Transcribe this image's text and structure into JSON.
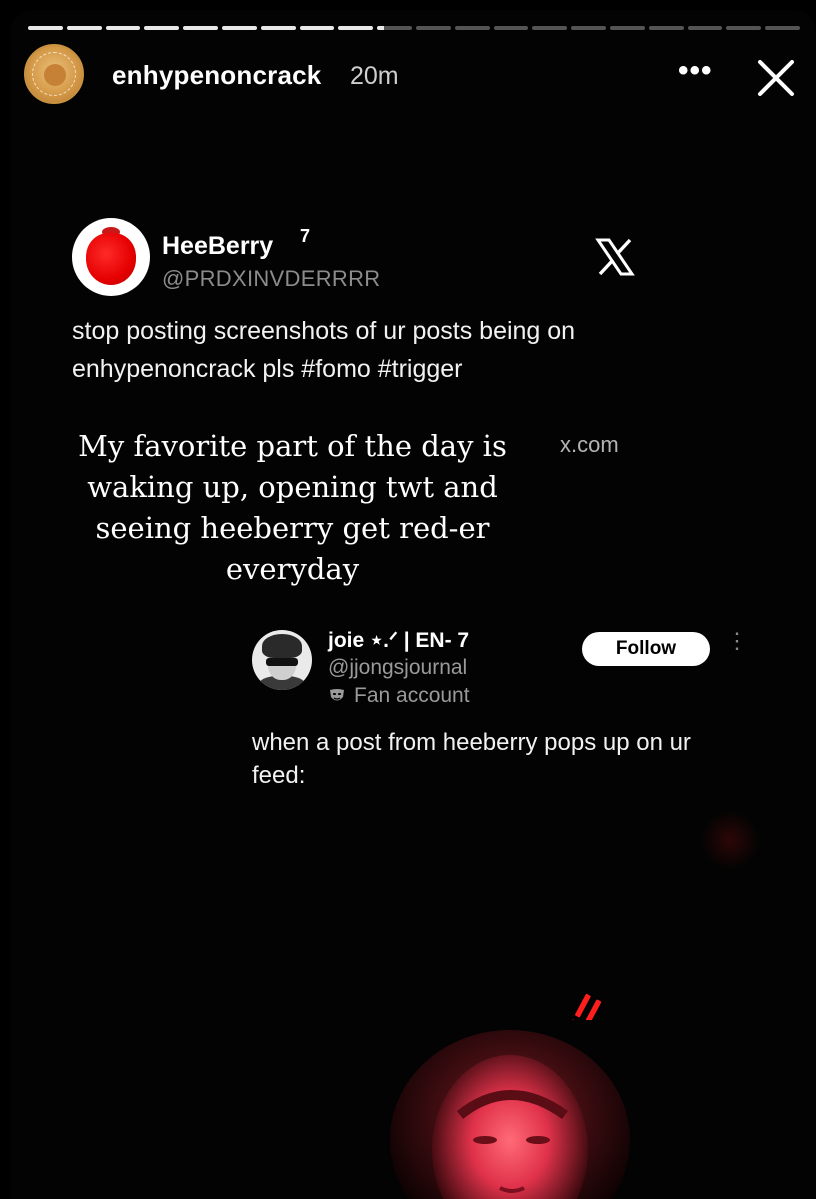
{
  "story": {
    "progress_segments_total": 20,
    "progress_current_index": 9,
    "current_progress": 0.2,
    "account": {
      "username": "enhypenoncrack",
      "posted_ago": "20m",
      "avatar_icon": "profile-avatar"
    },
    "actions": {
      "more_icon": "more-icon",
      "more_glyph": "•••",
      "close_icon": "close-icon"
    }
  },
  "tweet": {
    "display_name": "HeeBerry",
    "badge": "7",
    "handle": "@PRDXINVDERRRR",
    "platform_icon": "x-logo-icon",
    "text": "stop posting screenshots of ur posts being on enhypenoncrack pls #fomo #trigger",
    "media": {
      "caption": "My favorite part of the day is waking up, opening twt and seeing heeberry get red-er everyday",
      "source": "x.com",
      "embedded_post": {
        "display_name": "joie ⋆.ᐟ | EN- 7",
        "handle": "@jjongsjournal",
        "label": "Fan account",
        "follow_label": "Follow",
        "more_glyph": "⋮",
        "text": "when a post from heeberry pops up on ur feed:"
      }
    }
  },
  "colors": {
    "background": "#000000",
    "accent_red": "#ff1e1e",
    "avatar_gold": "#d59a48",
    "muted_text": "#8c8c8c"
  }
}
